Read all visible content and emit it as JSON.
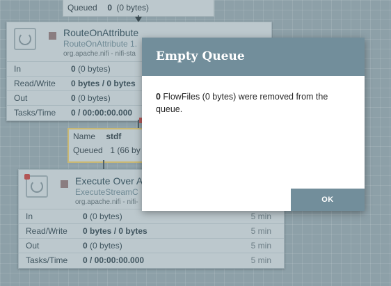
{
  "top_connection": {
    "queued_label": "Queued",
    "queued_count": "0",
    "queued_size": "(0 bytes)"
  },
  "processors": [
    {
      "name": "RouteOnAttribute",
      "type": "RouteOnAttribute 1.",
      "bundle": "org.apache.nifi - nifi-sta",
      "stats": [
        {
          "label": "In",
          "value_bold": "0",
          "value_rest": " (0 bytes)",
          "time": ""
        },
        {
          "label": "Read/Write",
          "value_bold": "0 bytes / 0 bytes",
          "value_rest": "",
          "time": ""
        },
        {
          "label": "Out",
          "value_bold": "0",
          "value_rest": " (0 bytes)",
          "time": ""
        },
        {
          "label": "Tasks/Time",
          "value_bold": "0 / 00:00:00.000",
          "value_rest": "",
          "time": ""
        }
      ]
    },
    {
      "name": "Execute Over A",
      "type": "ExecuteStreamC",
      "bundle": "org.apache.nifi - nifi-",
      "stats": [
        {
          "label": "In",
          "value_bold": "0",
          "value_rest": " (0 bytes)",
          "time": "5 min"
        },
        {
          "label": "Read/Write",
          "value_bold": "0 bytes / 0 bytes",
          "value_rest": "",
          "time": "5 min"
        },
        {
          "label": "Out",
          "value_bold": "0",
          "value_rest": " (0 bytes)",
          "time": "5 min"
        },
        {
          "label": "Tasks/Time",
          "value_bold": "0 / 00:00:00.000",
          "value_rest": "",
          "time": "5 min"
        }
      ]
    }
  ],
  "connection_stdf": {
    "name_label": "Name",
    "name_value": "stdf",
    "queued_label": "Queued",
    "queued_value": "1 (66 by"
  },
  "dialog": {
    "title": "Empty Queue",
    "message_count": "0",
    "message_text": " FlowFiles (0 bytes) were removed from the queue.",
    "ok_label": "OK"
  },
  "colors": {
    "dialog_header": "#728e9b",
    "canvas": "#8da0a8"
  }
}
